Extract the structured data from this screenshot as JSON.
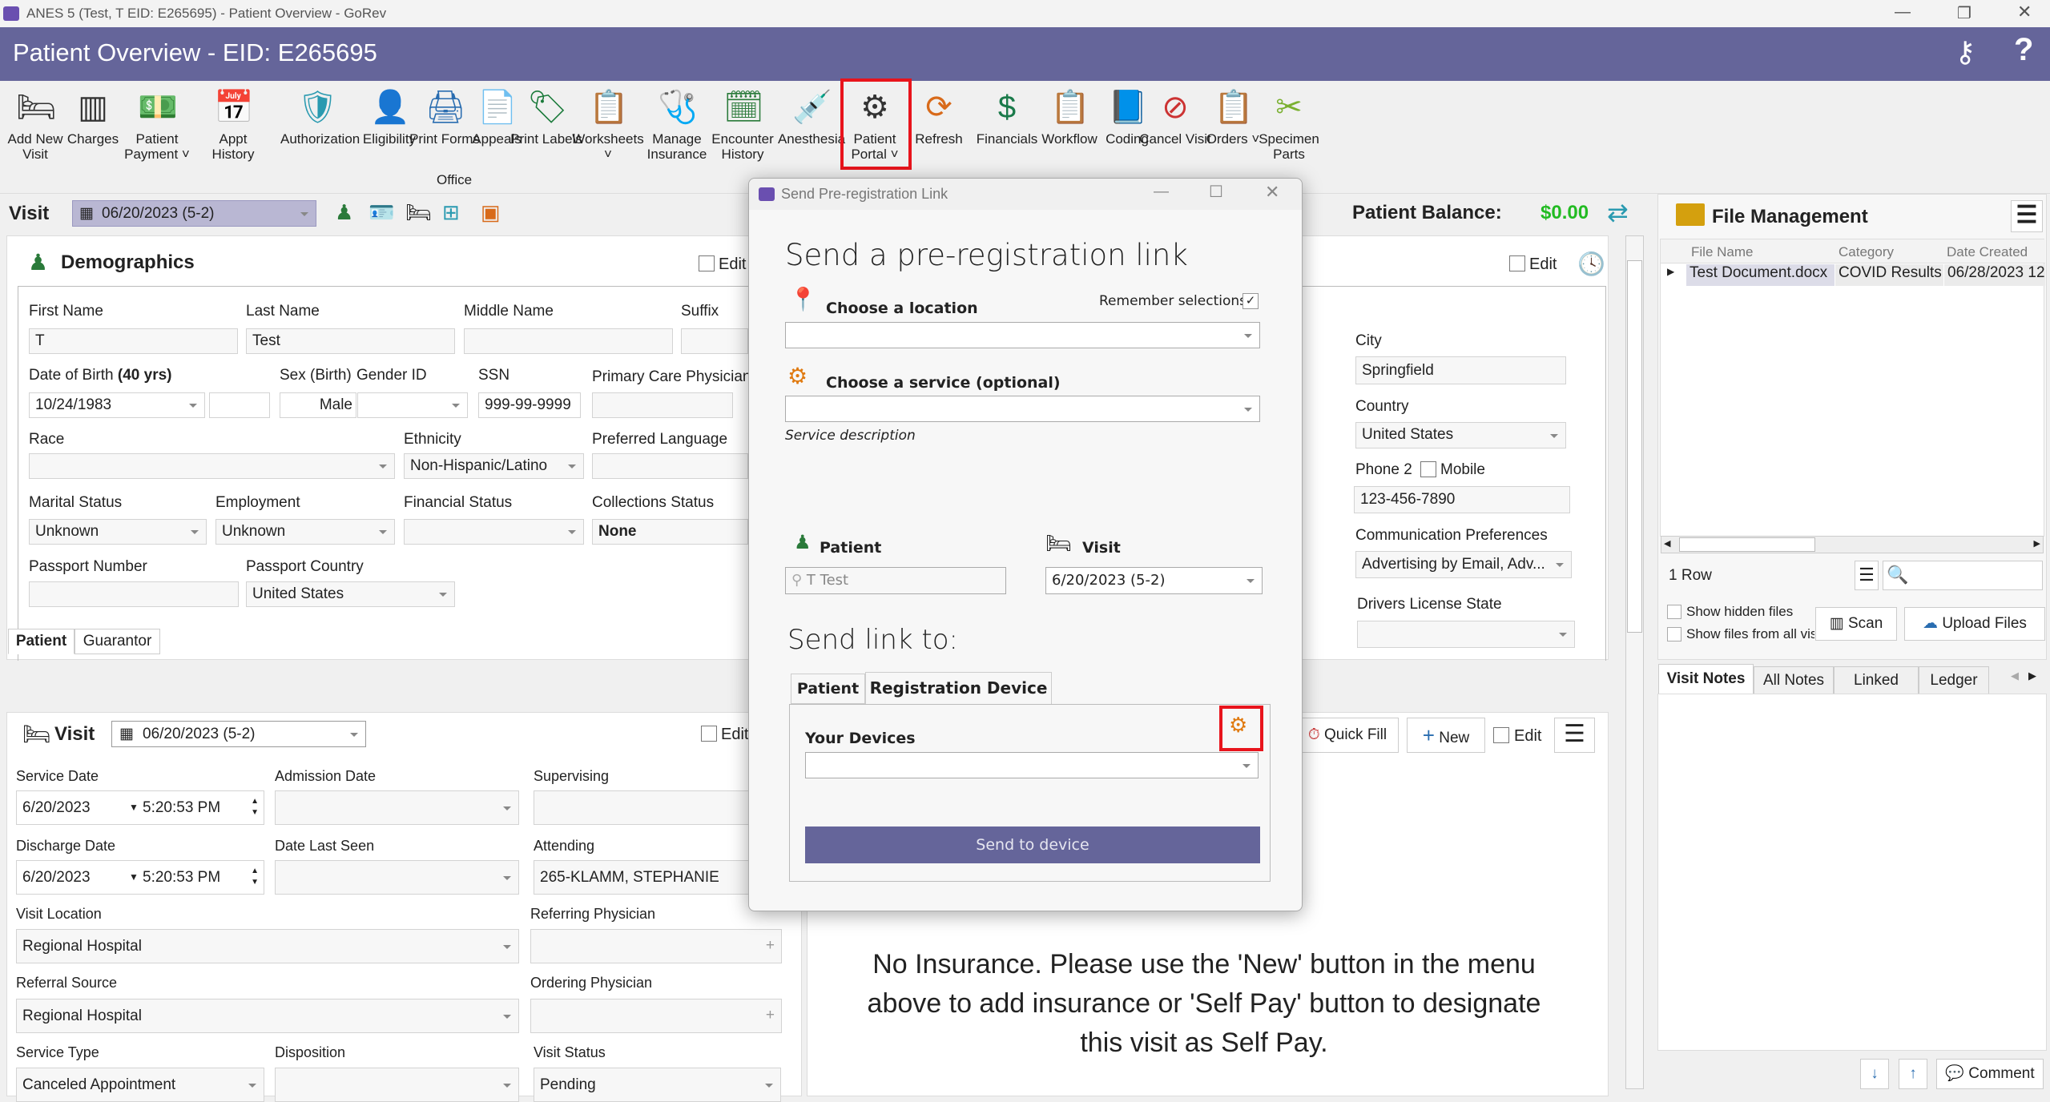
{
  "window": {
    "title": "ANES 5 (Test, T EID: E265695) - Patient Overview - GoRev"
  },
  "header": {
    "title": "Patient Overview - EID: E265695"
  },
  "toolbar": {
    "items": [
      {
        "label": "Add New Visit",
        "icon": "bed-plus-icon",
        "glyph": "🛏",
        "color": "#333"
      },
      {
        "label": "Charges",
        "icon": "barcode-icon",
        "glyph": "▥",
        "color": "#333"
      },
      {
        "label": "Patient Payment ˅",
        "icon": "money-hand-icon",
        "glyph": "💵",
        "color": "#2a7a3a"
      },
      {
        "label": "Appt History",
        "icon": "calendar-icon",
        "glyph": "📅",
        "color": "#c33"
      },
      {
        "label": "Authorization",
        "icon": "shield-check-icon",
        "glyph": "🛡",
        "color": "#2a9ab0"
      },
      {
        "label": "Eligibility",
        "icon": "user-check-icon",
        "glyph": "👤",
        "color": "#333"
      },
      {
        "label": "Print Forms",
        "icon": "printer-icon",
        "glyph": "🖨",
        "color": "#2a6db0"
      },
      {
        "label": "Appeals",
        "icon": "documents-icon",
        "glyph": "📄",
        "color": "#2a6db0"
      },
      {
        "label": "Print Labels",
        "icon": "tag-icon",
        "glyph": "🏷",
        "color": "#1a7a3a"
      },
      {
        "label": "Worksheets ˅",
        "icon": "worksheet-icon",
        "glyph": "📋",
        "color": "#d86a1a"
      },
      {
        "label": "Manage Insurance",
        "icon": "insurance-icon",
        "glyph": "🩺",
        "color": "#2a9ab0"
      },
      {
        "label": "Encounter History",
        "icon": "encounter-history-icon",
        "glyph": "🗓",
        "color": "#2a7a3a"
      },
      {
        "label": "Anesthesia",
        "icon": "syringe-icon",
        "glyph": "💉",
        "color": "#8a5ac0"
      },
      {
        "label": "Patient Portal ˅",
        "icon": "globe-gear-icon",
        "glyph": "⚙",
        "color": "#333"
      },
      {
        "label": "Refresh",
        "icon": "refresh-icon",
        "glyph": "⟳",
        "color": "#d86a1a"
      },
      {
        "label": "Financials",
        "icon": "dollar-icon",
        "glyph": "$",
        "color": "#1a7a4a"
      },
      {
        "label": "Workflow",
        "icon": "clipboard-icon",
        "glyph": "📋",
        "color": "#2a6db0"
      },
      {
        "label": "Coding",
        "icon": "book-icon",
        "glyph": "📘",
        "color": "#1a6db0"
      },
      {
        "label": "Cancel Visit",
        "icon": "cancel-clock-icon",
        "glyph": "⊘",
        "color": "#c33"
      },
      {
        "label": "Orders ˅",
        "icon": "orders-icon",
        "glyph": "📋",
        "color": "#d86a1a"
      },
      {
        "label": "Specimen Parts",
        "icon": "specimen-icon",
        "glyph": "✂",
        "color": "#7ab030"
      }
    ],
    "group_office": "Office"
  },
  "visit_bar": {
    "label": "Visit",
    "selected": "06/20/2023 (5-2)",
    "balance_label": "Patient Balance:",
    "balance": "$0.00"
  },
  "demographics": {
    "title": "Demographics",
    "edit": "Edit",
    "first_name": {
      "label": "First Name",
      "value": "T"
    },
    "last_name": {
      "label": "Last Name",
      "value": "Test"
    },
    "middle_name": {
      "label": "Middle Name",
      "value": ""
    },
    "suffix": {
      "label": "Suffix",
      "value": ""
    },
    "dob": {
      "label": "Date of Birth",
      "age": "(40 yrs)",
      "value": "10/24/1983"
    },
    "sex": {
      "label": "Sex (Birth)",
      "value": "Male"
    },
    "gender": {
      "label": "Gender ID",
      "value": ""
    },
    "ssn": {
      "label": "SSN",
      "value": "999-99-9999"
    },
    "pcp": {
      "label": "Primary Care Physician",
      "value": ""
    },
    "race": {
      "label": "Race",
      "value": ""
    },
    "ethnicity": {
      "label": "Ethnicity",
      "value": "Non-Hispanic/Latino"
    },
    "language": {
      "label": "Preferred Language",
      "value": ""
    },
    "marital": {
      "label": "Marital Status",
      "value": "Unknown"
    },
    "employment": {
      "label": "Employment",
      "value": "Unknown"
    },
    "financial": {
      "label": "Financial Status",
      "value": ""
    },
    "collections": {
      "label": "Collections Status",
      "value": "None"
    },
    "passport_number": {
      "label": "Passport Number",
      "value": ""
    },
    "passport_country": {
      "label": "Passport Country",
      "value": "United States"
    },
    "city": {
      "label": "City",
      "value": "Springfield"
    },
    "country": {
      "label": "Country",
      "value": "United States"
    },
    "phone2": {
      "label": "Phone 2",
      "mobile": "Mobile",
      "value": "123-456-7890"
    },
    "comm_pref": {
      "label": "Communication Preferences",
      "value": "Advertising by Email, Adv..."
    },
    "dl_state": {
      "label": "Drivers License State",
      "value": ""
    },
    "tabs": [
      "Patient",
      "Guarantor"
    ]
  },
  "visit": {
    "title": "Visit",
    "selected": "06/20/2023 (5-2)",
    "edit": "Edit",
    "service_date": {
      "label": "Service Date",
      "date": "6/20/2023",
      "time": "5:20:53 PM"
    },
    "admission_date": {
      "label": "Admission Date",
      "value": ""
    },
    "supervising": {
      "label": "Supervising",
      "value": ""
    },
    "discharge_date": {
      "label": "Discharge Date",
      "date": "6/20/2023",
      "time": "5:20:53 PM"
    },
    "date_last_seen": {
      "label": "Date Last Seen",
      "value": ""
    },
    "attending": {
      "label": "Attending",
      "value": "265-KLAMM, STEPHANIE"
    },
    "visit_location": {
      "label": "Visit Location",
      "value": "Regional Hospital"
    },
    "referring": {
      "label": "Referring Physician",
      "value": ""
    },
    "referral_source": {
      "label": "Referral Source",
      "value": "Regional Hospital"
    },
    "ordering": {
      "label": "Ordering Physician",
      "value": ""
    },
    "service_type": {
      "label": "Service Type",
      "value": "Canceled Appointment"
    },
    "disposition": {
      "label": "Disposition",
      "value": ""
    },
    "visit_status": {
      "label": "Visit Status",
      "value": "Pending"
    }
  },
  "insurance": {
    "quick_fill": "Quick Fill",
    "new": "New",
    "edit": "Edit",
    "message": "No Insurance.  Please use the 'New' button in the menu above to add insurance or 'Self Pay' button to designate this visit as Self Pay."
  },
  "files": {
    "title": "File Management",
    "columns": [
      "File Name",
      "Category",
      "Date Created"
    ],
    "rows": [
      [
        "Test Document.docx",
        "COVID Results",
        "06/28/2023 12"
      ]
    ],
    "row_count": "1 Row",
    "show_hidden": "Show hidden files",
    "show_all": "Show files from all visits",
    "scan": "Scan",
    "upload": "Upload Files"
  },
  "notes": {
    "tabs": [
      "Visit Notes",
      "All Notes",
      "Linked Visits",
      "Ledger"
    ],
    "comment": "Comment"
  },
  "dialog": {
    "title": "Send Pre-registration Link",
    "heading": "Send a pre-registration link",
    "location_label": "Choose a location",
    "remember": "Remember selections",
    "remember_checked": true,
    "location_value": "",
    "service_label": "Choose a service (optional)",
    "service_value": "",
    "service_description": "Service description",
    "patient_label": "Patient",
    "patient_value": "T Test",
    "visit_label": "Visit",
    "visit_value": "6/20/2023 (5-2)",
    "send_to": "Send link to:",
    "tabs": [
      "Patient",
      "Registration Device"
    ],
    "active_tab": "Registration Device",
    "devices_label": "Your Devices",
    "devices_value": "",
    "send_button": "Send to device"
  },
  "colors": {
    "brand": "#65659a",
    "balance": "#22bb22",
    "highlight": "#e8141c"
  }
}
